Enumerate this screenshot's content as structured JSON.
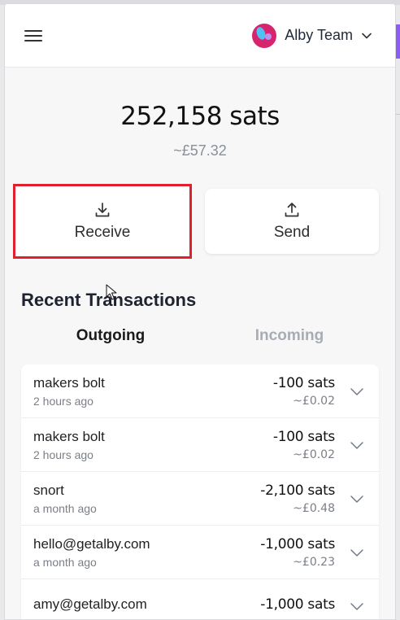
{
  "header": {
    "account_name": "Alby Team",
    "menu_icon": "hamburger-menu-icon",
    "avatar_colors": [
      "#d6246e",
      "#4ec2f0",
      "#b794f4"
    ]
  },
  "balance": {
    "sats": "252,158 sats",
    "fiat": "~£57.32"
  },
  "actions": {
    "receive_label": "Receive",
    "send_label": "Send"
  },
  "transactions": {
    "title": "Recent Transactions",
    "tabs": [
      {
        "label": "Outgoing",
        "active": true
      },
      {
        "label": "Incoming",
        "active": false
      }
    ],
    "items": [
      {
        "name": "makers bolt",
        "time": "2 hours ago",
        "amount": "-100 sats",
        "fiat": "~£0.02"
      },
      {
        "name": "makers bolt",
        "time": "2 hours ago",
        "amount": "-100 sats",
        "fiat": "~£0.02"
      },
      {
        "name": "snort",
        "time": "a month ago",
        "amount": "-2,100 sats",
        "fiat": "~£0.48"
      },
      {
        "name": "hello@getalby.com",
        "time": "a month ago",
        "amount": "-1,000 sats",
        "fiat": "~£0.23"
      },
      {
        "name": "amy@getalby.com",
        "time": "",
        "amount": "-1,000 sats",
        "fiat": ""
      }
    ]
  },
  "colors": {
    "highlight": "#e0202c",
    "accent": "#8b5cf6"
  }
}
